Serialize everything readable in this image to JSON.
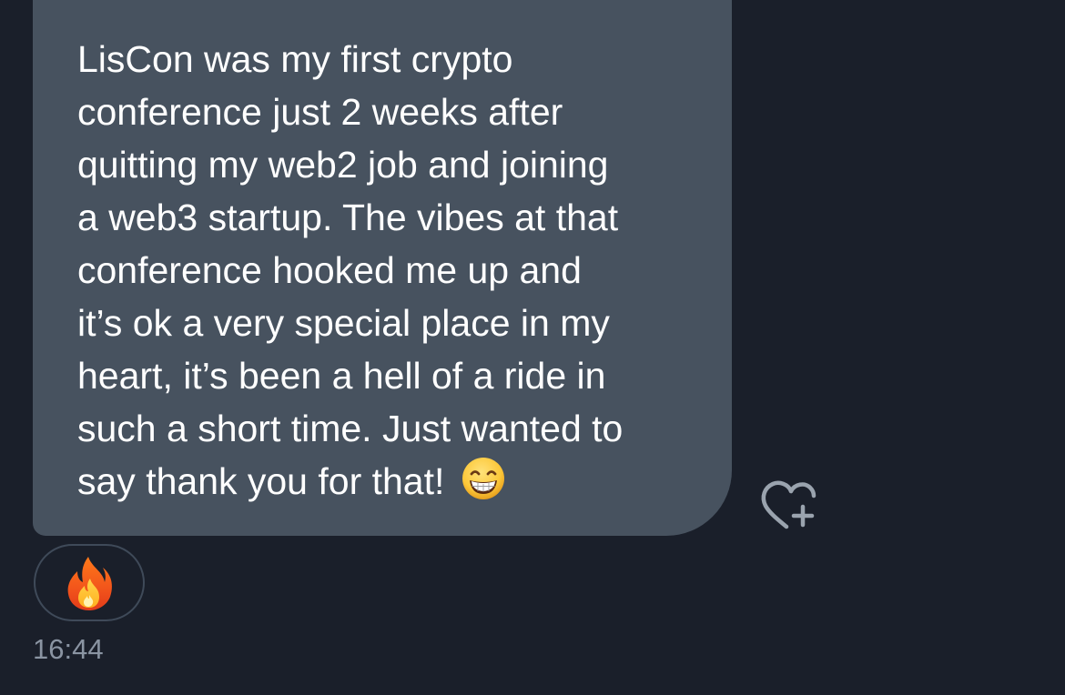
{
  "message": {
    "lines": [
      "LisCon was my first crypto",
      "conference just 2 weeks after",
      "quitting my web2 job and joining",
      "a web3 startup. The vibes at that",
      "conference hooked me up and",
      "it’s ok a very special place in my",
      "heart, it’s been a hell of a ride in",
      "such a short time. Just wanted to",
      "say thank you for that! "
    ],
    "trailing_emoji": "grinning-face-with-smiling-eyes"
  },
  "reaction": {
    "emoji": "fire"
  },
  "add_reaction_icon": "heart-plus-icon",
  "timestamp": "16:44",
  "colors": {
    "background": "#1a1f2a",
    "bubble": "#47525f",
    "text": "#ffffff",
    "muted": "#8a94a2",
    "pill_border": "#3f4a59"
  }
}
